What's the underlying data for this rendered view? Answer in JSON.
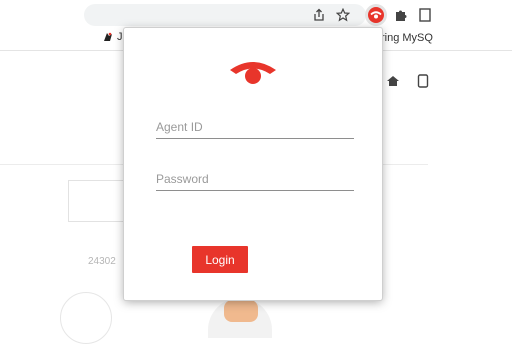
{
  "browser": {
    "bookmarks": {
      "left_item": "J",
      "right_item": "ring MySQ"
    },
    "icons": [
      "share-icon",
      "star-icon",
      "extension-active-icon",
      "puzzle-icon",
      "side-panel-icon"
    ]
  },
  "background": {
    "partial_number": "24302"
  },
  "popup": {
    "brand_color": "#e8352b",
    "agent_id": {
      "placeholder": "Agent ID",
      "value": ""
    },
    "password": {
      "placeholder": "Password",
      "value": ""
    },
    "login_label": "Login"
  }
}
